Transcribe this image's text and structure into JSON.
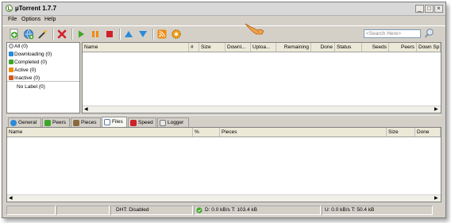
{
  "window": {
    "title": "µTorrent 1.7.7",
    "controls": [
      "_",
      "□",
      "×"
    ]
  },
  "menu": [
    "File",
    "Options",
    "Help"
  ],
  "toolbar": {
    "buttons": [
      "add-torrent-icon",
      "add-url-icon",
      "create-torrent-icon",
      "remove-icon",
      "start-icon",
      "pause-icon",
      "stop-icon",
      "move-up-icon",
      "move-down-icon",
      "rss-icon",
      "preferences-icon"
    ]
  },
  "search": {
    "placeholder": "<Search Here>"
  },
  "categories": [
    {
      "label": "All (0)",
      "icon": "all-icon"
    },
    {
      "label": "Downloading (0)",
      "icon": "downloading-icon"
    },
    {
      "label": "Completed (0)",
      "icon": "completed-icon"
    },
    {
      "label": "Active (0)",
      "icon": "active-icon"
    },
    {
      "label": "Inactive (0)",
      "icon": "inactive-icon"
    }
  ],
  "labels": {
    "no_label": "No Label (0)"
  },
  "torrent_columns": [
    "Name",
    "#",
    "Size",
    "Downl...",
    "Uploa...",
    "Remaining",
    "Done",
    "Status",
    "Seeds",
    "Peers",
    "Down Sp."
  ],
  "tabs": [
    {
      "label": "General",
      "icon": "info-icon"
    },
    {
      "label": "Peers",
      "icon": "peers-icon"
    },
    {
      "label": "Pieces",
      "icon": "pieces-icon"
    },
    {
      "label": "Files",
      "icon": "files-icon",
      "active": true
    },
    {
      "label": "Speed",
      "icon": "speed-icon"
    },
    {
      "label": "Logger",
      "icon": "logger-icon"
    }
  ],
  "file_columns": [
    "Name",
    "%",
    "Pieces",
    "Size",
    "Done"
  ],
  "status": {
    "dht": "DHT: Disabled",
    "download": "D: 0.0 kB/s T: 103.4 kB",
    "upload": "U: 0.0 kB/s T: 50.4 kB"
  },
  "colors": {
    "accent_green": "#3fa52a",
    "accent_red": "#d0202a",
    "accent_orange": "#f08a10",
    "accent_blue": "#2a8ad8"
  }
}
